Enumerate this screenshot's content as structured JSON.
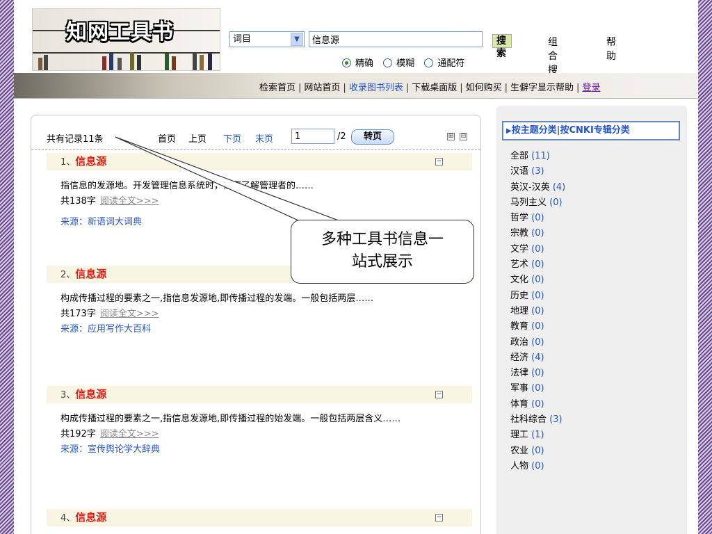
{
  "header": {
    "logo_text": "知网工具书",
    "field_select": "词目",
    "search_value": "信息源",
    "search_button": "搜 索",
    "combo_search": "组合搜索",
    "help": "帮助",
    "match_modes": [
      "精确",
      "模糊",
      "通配符"
    ],
    "selected_mode": "精确"
  },
  "nav": {
    "links": [
      "检索首页",
      "网站首页",
      "收录图书列表",
      "下载桌面版",
      "如何购买",
      "生僻字显示帮助",
      "登录"
    ]
  },
  "pager": {
    "total": "共有记录11条",
    "first": "首页",
    "prev": "上页",
    "next": "下页",
    "last": "末页",
    "page_value": "1",
    "of_pages": "/2",
    "goto": "转页",
    "expand_icon": "⊞",
    "collapse_icon": "⊟"
  },
  "results": [
    {
      "num": "1、",
      "keyword": "信息源",
      "text": "指信息的发源地。开发管理信息系统时，需要了解管理者的……",
      "chars": "共138字",
      "more": "阅读全文>>>",
      "source": "来源：新语词大词典"
    },
    {
      "num": "2、",
      "keyword": "信息源",
      "text": "构成传播过程的要素之一,指信息发源地,即传播过程的发端。一般包括两层……",
      "chars": "共173字",
      "more": "阅读全文>>>",
      "source": "来源：应用写作大百科"
    },
    {
      "num": "3、",
      "keyword": "信息源",
      "text": "构成传播过程的要素之一,指信息发源地,即传播过程的始发端。一般包括两层含义……",
      "chars": "共192字",
      "more": "阅读全文>>>",
      "source": "来源：宣传舆论学大辞典"
    },
    {
      "num": "4、",
      "keyword": "信息源"
    }
  ],
  "sidebar": {
    "tab_subject": "按主题分类",
    "tab_cnki": "按CNKI专辑分类",
    "categories": [
      {
        "name": "全部",
        "count": "(11)"
      },
      {
        "name": "汉语",
        "count": "(3)"
      },
      {
        "name": "英汉-汉英",
        "count": "(4)"
      },
      {
        "name": "马列主义",
        "count": "(0)"
      },
      {
        "name": "哲学",
        "count": "(0)"
      },
      {
        "name": "宗教",
        "count": "(0)"
      },
      {
        "name": "文学",
        "count": "(0)"
      },
      {
        "name": "艺术",
        "count": "(0)"
      },
      {
        "name": "文化",
        "count": "(0)"
      },
      {
        "name": "历史",
        "count": "(0)"
      },
      {
        "name": "地理",
        "count": "(0)"
      },
      {
        "name": "教育",
        "count": "(0)"
      },
      {
        "name": "政治",
        "count": "(0)"
      },
      {
        "name": "经济",
        "count": "(4)"
      },
      {
        "name": "法律",
        "count": "(0)"
      },
      {
        "name": "军事",
        "count": "(0)"
      },
      {
        "name": "体育",
        "count": "(0)"
      },
      {
        "name": "社科综合",
        "count": "(3)"
      },
      {
        "name": "理工",
        "count": "(1)"
      },
      {
        "name": "农业",
        "count": "(0)"
      },
      {
        "name": "人物",
        "count": "(0)"
      }
    ]
  },
  "callout": {
    "line1": "多种工具书信息一",
    "line2": "站式展示"
  },
  "colors": {
    "keyword": "#e0201a",
    "link": "#2255cc",
    "result_header_bg": "#f8f6e3",
    "side_bg": "#efefef"
  }
}
